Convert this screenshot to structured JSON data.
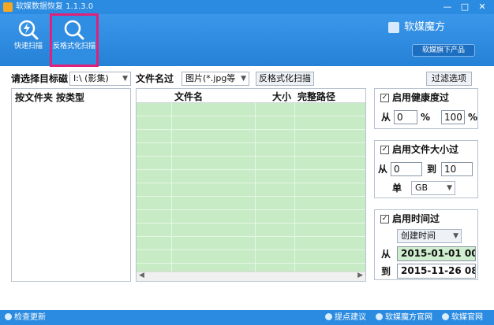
{
  "window": {
    "title": "软媒数据恢复 1.1.3.0",
    "controls": [
      "—",
      "□",
      "✕"
    ]
  },
  "toolbar": {
    "tools": [
      {
        "label": "快速扫描",
        "icon": "lightning-search-icon",
        "active": false
      },
      {
        "label": "反格式化扫描",
        "icon": "magnifier-icon",
        "active": true
      }
    ],
    "brand": "软媒魔方",
    "brand_sub": "软媒旗下产品"
  },
  "controls": {
    "target_label": "请选择目标磁",
    "target_value": "I:\\ (影集)",
    "filename_label": "文件名过",
    "filename_value": "图片(*.jpg等",
    "scan_button": "反格式化扫描",
    "filter_button": "过滤选项"
  },
  "tree": {
    "tabs": [
      "按文件夹",
      "按类型"
    ]
  },
  "grid": {
    "columns": [
      "文件名",
      "大小",
      "完整路径"
    ]
  },
  "filters": {
    "health": {
      "checked": true,
      "label": "启用健康度过",
      "from_label": "从",
      "from_value": "0",
      "unit": "%",
      "to_value": "100"
    },
    "size": {
      "checked": true,
      "label": "启用文件大小过",
      "from_label": "从",
      "from_value": "0",
      "to_label": "到",
      "to_value": "10",
      "unit_label": "单",
      "unit_value": "GB"
    },
    "time": {
      "checked": true,
      "label": "启用时间过",
      "mode": "创建时间",
      "from_label": "从",
      "from_date": "2015-01-01 00:",
      "to_label": "到",
      "to_date": "2015-11-26 08:"
    }
  },
  "statusbar": {
    "check_update": "检查更新",
    "feedback": "提点建议",
    "site1": "软媒魔方官网",
    "site2": "软媒官网"
  },
  "colors": {
    "accent": "#2b8be0",
    "active_outline": "#e0217a",
    "grid_fill": "#c7ecc5"
  }
}
